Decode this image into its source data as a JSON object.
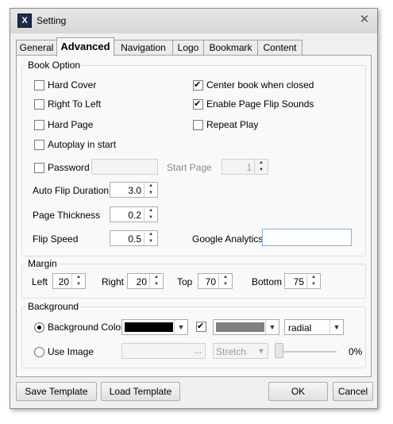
{
  "window": {
    "title": "Setting"
  },
  "tabs": [
    "General",
    "Advanced",
    "Navigation",
    "Logo",
    "Bookmark",
    "Content"
  ],
  "active_tab": "Advanced",
  "book_option": {
    "title": "Book Option",
    "hard_cover": {
      "label": "Hard Cover",
      "checked": false
    },
    "right_to_left": {
      "label": "Right To Left",
      "checked": false
    },
    "hard_page": {
      "label": "Hard Page",
      "checked": false
    },
    "autoplay": {
      "label": "Autoplay in start",
      "checked": false
    },
    "center_book": {
      "label": "Center book when closed",
      "checked": true
    },
    "flip_sounds": {
      "label": "Enable Page Flip Sounds",
      "checked": true
    },
    "repeat_play": {
      "label": "Repeat Play",
      "checked": false
    },
    "password": {
      "label": "Password",
      "checked": false,
      "value": ""
    },
    "start_page": {
      "label": "Start Page",
      "value": "1"
    },
    "auto_flip_duration": {
      "label": "Auto Flip Duration",
      "value": "3.0"
    },
    "page_thickness": {
      "label": "Page Thickness",
      "value": "0.2"
    },
    "flip_speed": {
      "label": "Flip Speed",
      "value": "0.5"
    },
    "google_analytics": {
      "label": "Google Analytics",
      "value": ""
    }
  },
  "margin": {
    "title": "Margin",
    "left": {
      "label": "Left",
      "value": "20"
    },
    "right": {
      "label": "Right",
      "value": "20"
    },
    "top": {
      "label": "Top",
      "value": "70"
    },
    "bottom": {
      "label": "Bottom",
      "value": "75"
    }
  },
  "background": {
    "title": "Background",
    "bg_color": {
      "label": "Background Color",
      "selected": true,
      "color": "#000000"
    },
    "gradient_checked": true,
    "gradient_color": "#808080",
    "gradient_type": "radial",
    "use_image": {
      "label": "Use Image",
      "selected": false,
      "browse": "...",
      "fit": "Stretch",
      "opacity": "0%"
    }
  },
  "footer": {
    "save_template": "Save  Template",
    "load_template": "Load  Template",
    "ok": "OK",
    "cancel": "Cancel"
  }
}
